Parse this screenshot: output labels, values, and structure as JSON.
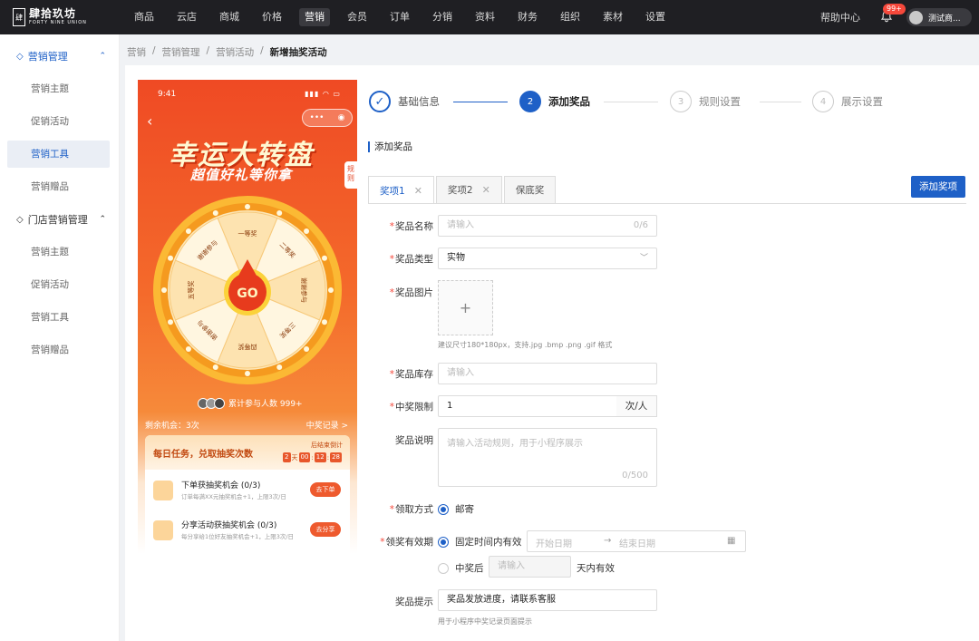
{
  "brand": {
    "name_cn": "肆拾玖坊",
    "name_en": "FORTY NINE UNION",
    "mark": "肆"
  },
  "topnav": {
    "items": [
      "商品",
      "云店",
      "商城",
      "价格",
      "营销",
      "会员",
      "订单",
      "分销",
      "资料",
      "财务",
      "组织",
      "素材",
      "设置"
    ],
    "active": "营销",
    "help": "帮助中心",
    "notification_count": "99+",
    "user_name": "测试商..."
  },
  "sidebar": {
    "group1": "营销管理",
    "group1_items": [
      "营销主题",
      "促销活动",
      "营销工具",
      "营销赠品"
    ],
    "group1_active": "营销工具",
    "group2": "门店营销管理",
    "group2_items": [
      "营销主题",
      "促销活动",
      "营销工具",
      "营销赠品"
    ]
  },
  "breadcrumb": [
    "营销",
    "营销管理",
    "营销活动",
    "新增抽奖活动"
  ],
  "phone": {
    "time": "9:41",
    "title": "幸运大转盘",
    "subtitle": "超值好礼等你拿",
    "rule_tab": "规则",
    "go": "GO",
    "wheel_segments": [
      "一等奖",
      "二等奖",
      "谢谢参与",
      "三等奖",
      "四等奖",
      "谢谢参与",
      "五等奖",
      "谢谢参与"
    ],
    "joined": "累计参与人数 999+",
    "chances_left": "剩余机会：3次",
    "prize_record": "中奖记录 >",
    "task_title": "每日任务，兑取抽奖次数",
    "task_refresh": "后结束倒计",
    "countdown": [
      "2",
      "天",
      "00",
      ":",
      "12",
      ":",
      "28"
    ],
    "tasks": [
      {
        "name": "下单获抽奖机会 (0/3)",
        "desc": "订单每满XX元抽奖机会+1，上限3次/日",
        "btn": "去下单"
      },
      {
        "name": "分享活动获抽奖机会 (0/3)",
        "desc": "每分享给1位好友抽奖机会+1，上限3次/日",
        "btn": "去分享"
      }
    ]
  },
  "steps": [
    {
      "num": "✓",
      "label": "基础信息",
      "state": "done"
    },
    {
      "num": "2",
      "label": "添加奖品",
      "state": "current"
    },
    {
      "num": "3",
      "label": "规则设置",
      "state": "todo"
    },
    {
      "num": "4",
      "label": "展示设置",
      "state": "todo"
    }
  ],
  "section_title": "添加奖品",
  "tabs": [
    {
      "label": "奖项1",
      "closable": true
    },
    {
      "label": "奖项2",
      "closable": true
    },
    {
      "label": "保底奖",
      "closable": false
    }
  ],
  "add_prize_button": "添加奖项",
  "form": {
    "name_label": "奖品名称",
    "name_placeholder": "请输入",
    "name_count": "0/6",
    "type_label": "奖品类型",
    "type_value": "实物",
    "image_label": "奖品图片",
    "image_hint": "建议尺寸180*180px，支持.jpg .bmp .png .gif 格式",
    "stock_label": "奖品库存",
    "stock_placeholder": "请输入",
    "limit_label": "中奖限制",
    "limit_value": "1",
    "limit_unit": "次/人",
    "desc_label": "奖品说明",
    "desc_placeholder": "请输入活动规则，用于小程序展示",
    "desc_count": "0/500",
    "claim_label": "领取方式",
    "claim_option": "邮寄",
    "validity_label": "领奖有效期",
    "validity_opt1": "固定时间内有效",
    "start_placeholder": "开始日期",
    "range_sep": "→",
    "end_placeholder": "结束日期",
    "validity_opt2": "中奖后",
    "days_placeholder": "请输入",
    "days_suffix": "天内有效",
    "tip_label": "奖品提示",
    "tip_value": "奖品发放进度，请联系客服",
    "tip_hint": "用于小程序中奖记录页面提示"
  }
}
